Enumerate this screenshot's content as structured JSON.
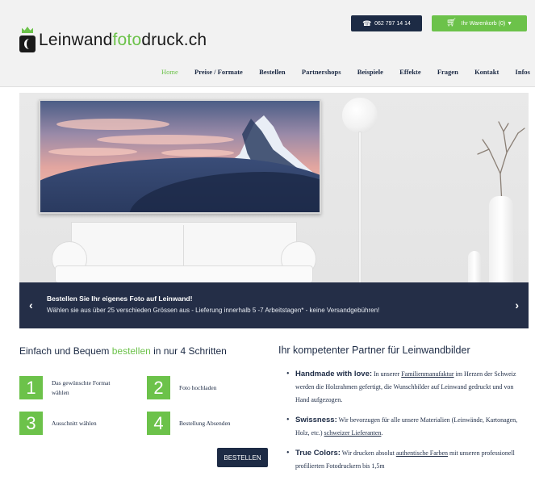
{
  "header": {
    "logo": {
      "dark_part": "Leinwand",
      "green_part": "foto",
      "dark_part2": "druck.ch"
    },
    "phone": "062 797 14 14",
    "cart": "Ihr Warenkorb (0) ▼",
    "nav": [
      "Home",
      "Preise / Formate",
      "Bestellen",
      "Partnershops",
      "Beispiele",
      "Effekte",
      "Fragen",
      "Kontakt",
      "Infos"
    ],
    "active_nav": "Home"
  },
  "slider": {
    "title": "Bestellen Sie Ihr eigenes Foto auf Leinwand!",
    "text": "Wählen sie aus über 25 verschieden Grössen aus - Lieferung innerhalb 5 -7 Arbeitstagen* - keine Versandgebühren!",
    "prev": "‹",
    "next": "›"
  },
  "steps": {
    "title_start": "Einfach und Bequem ",
    "title_highlight": "bestellen",
    "title_end": " in nur 4 Schritten",
    "items": [
      {
        "num": "1",
        "label": "Das gewünschte Format wählen"
      },
      {
        "num": "2",
        "label": "Foto hochladen"
      },
      {
        "num": "3",
        "label": "Ausschnitt wählen"
      },
      {
        "num": "4",
        "label": "Bestellung Absenden"
      }
    ],
    "button": "BESTELLEN"
  },
  "partner": {
    "title": "Ihr kompetenter Partner für Leinwandbilder",
    "features": [
      {
        "bold": "Handmade with love:",
        "pre": " In unserer ",
        "link": "Familienmanufaktur",
        "post": " im Herzen der Schweiz werden die Holzrahmen gefertigt, die Wunschbilder auf Leinwand gedruckt und von Hand aufgezogen."
      },
      {
        "bold": "Swissness:",
        "pre": " Wir bevorzugen für alle unsere Materialien (Leinwände, Kartonagen, Holz, etc.) ",
        "link": "schweizer Lieferanten",
        "post": "."
      },
      {
        "bold": "True Colors:",
        "pre": " Wir drucken absolut ",
        "link": "authentische Farben",
        "post": " mit unseren professionell profilierten Fotodruckern bis 1,5m"
      }
    ]
  },
  "colors": {
    "brand_green": "#6cc24a",
    "navy": "#1d2b45"
  }
}
